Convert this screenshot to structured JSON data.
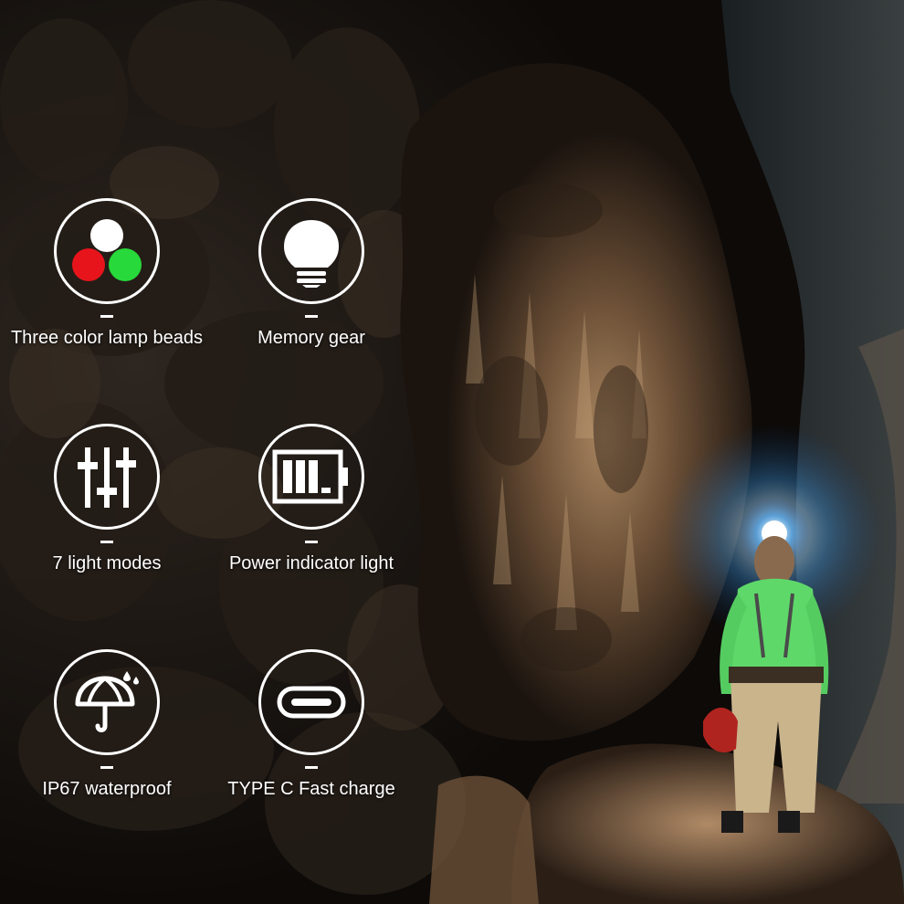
{
  "colors": {
    "icon_stroke": "#ffffff",
    "lamp_white": "#ffffff",
    "lamp_red": "#e8141b",
    "lamp_green": "#27d93a",
    "label_text": "#ffffff"
  },
  "features": [
    {
      "label": "Three color lamp beads",
      "icon": "three-color-lamp-beads-icon"
    },
    {
      "label": "Memory gear",
      "icon": "light-bulb-icon"
    },
    {
      "label": "7 light modes",
      "icon": "sliders-icon"
    },
    {
      "label": "Power indicator light",
      "icon": "battery-icon"
    },
    {
      "label": "IP67 waterproof",
      "icon": "umbrella-rain-icon"
    },
    {
      "label": "TYPE C Fast charge",
      "icon": "usb-type-c-port-icon"
    }
  ]
}
